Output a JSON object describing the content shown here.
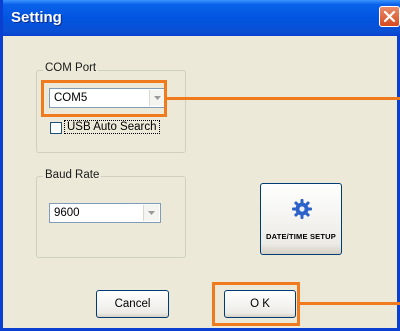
{
  "window": {
    "title": "Setting",
    "close_icon": "close-icon",
    "title_color": "#0a62ea",
    "accent": "#f07a1e"
  },
  "com_port": {
    "group_label": "COM Port",
    "selected": "COM5",
    "usb_auto_search_label": "USB Auto Search",
    "usb_auto_search_checked": false
  },
  "baud_rate": {
    "group_label": "Baud Rate",
    "selected": "9600"
  },
  "datetime_setup": {
    "label": "DATE/TIME SETUP",
    "icon": "gear-icon"
  },
  "buttons": {
    "cancel": "Cancel",
    "ok": "O K"
  }
}
